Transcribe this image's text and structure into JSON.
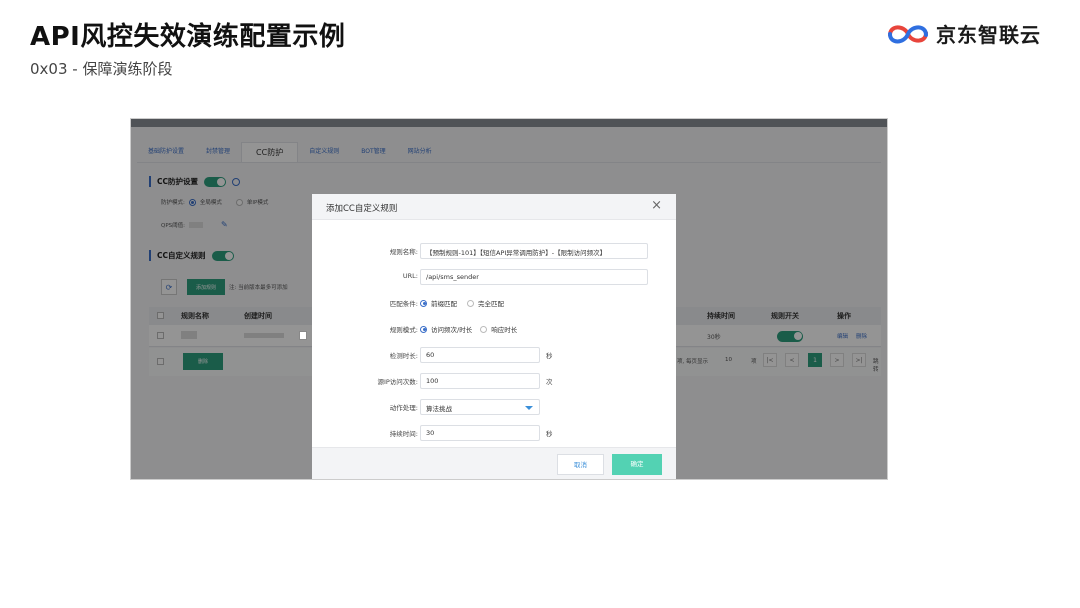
{
  "slide": {
    "title": "API风控失效演练配置示例",
    "subtitle": "0x03 - 保障演练阶段",
    "brand": "京东智联云"
  },
  "console": {
    "tabs": [
      "基础防护设置",
      "封禁管理",
      "CC防护",
      "自定义规则",
      "BOT管理",
      "网站分析"
    ],
    "cc_section": {
      "title": "CC防护设置",
      "mode_label": "防护模式:",
      "mode_options": [
        "全局模式",
        "单IP模式"
      ],
      "qps_label": "QPS阈值:"
    },
    "custom_section": {
      "title": "CC自定义规则",
      "add_button": "添加规则",
      "note": "注: 当前版本最多可添加",
      "delete_button": "删除"
    },
    "table": {
      "headers": [
        "规则名称",
        "创建时间",
        "持续时间",
        "规则开关",
        "操作"
      ],
      "row": {
        "duration": "30秒",
        "actions": [
          "编辑",
          "删除"
        ]
      },
      "pagination": {
        "text": "项, 每页显示",
        "page_size": "10",
        "unit": "项",
        "current_page": "1",
        "jump": "跳转"
      }
    }
  },
  "modal": {
    "title": "添加CC自定义规则",
    "fields": {
      "rule_name": {
        "label": "规则名称:",
        "value": "【预制规则-101】【短信API异常调用防护】-【限制访问频次】"
      },
      "url": {
        "label": "URL:",
        "value": "/api/sms_sender"
      },
      "match": {
        "label": "匹配条件:",
        "options": [
          "前缀匹配",
          "完全匹配"
        ],
        "selected": "前缀匹配"
      },
      "rule_mode": {
        "label": "规则模式:",
        "options": [
          "访问频次/时长",
          "响应时长"
        ],
        "selected": "访问频次/时长"
      },
      "detect_time": {
        "label": "检测时长:",
        "value": "60",
        "unit": "秒"
      },
      "ip_count": {
        "label": "源IP访问次数:",
        "value": "100",
        "unit": "次"
      },
      "action": {
        "label": "动作处理:",
        "value": "算法挑战"
      },
      "duration": {
        "label": "持续时间:",
        "value": "30",
        "unit": "秒"
      }
    },
    "cancel": "取消",
    "confirm": "确定"
  }
}
